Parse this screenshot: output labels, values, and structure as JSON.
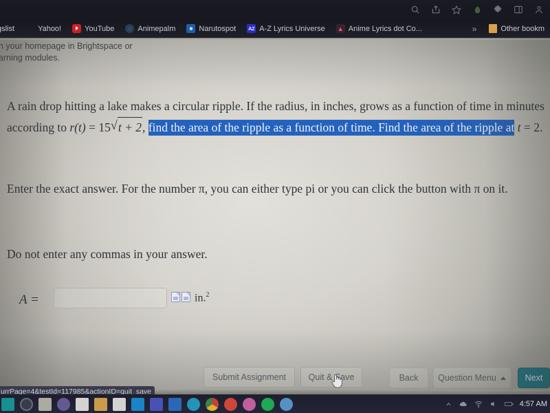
{
  "browser": {
    "toolbar_icons": [
      "search-icon",
      "share-icon",
      "star-icon",
      "leaf-icon",
      "extensions-puzzle-icon",
      "sidebar-icon",
      "profile-icon"
    ],
    "bookmarks": [
      {
        "label": "gslist",
        "icon": "generic-favicon"
      },
      {
        "label": "Yahoo!",
        "icon": "yahoo-favicon"
      },
      {
        "label": "YouTube",
        "icon": "youtube-favicon"
      },
      {
        "label": "Animepalm",
        "icon": "animepalm-favicon"
      },
      {
        "label": "Narutospot",
        "icon": "narutospot-favicon"
      },
      {
        "label": "A-Z Lyrics Universe",
        "icon": "az-lyrics-favicon"
      },
      {
        "label": "Anime Lyrics dot Co...",
        "icon": "anime-lyrics-favicon"
      }
    ],
    "overflow_label": "»",
    "other_bookmarks_label": "Other bookm"
  },
  "banner": {
    "line1": "n your homepage in Brightspace or",
    "line2": "arning modules."
  },
  "question": {
    "seg1": "A rain drop hitting a lake makes a circular ripple. If the radius, in inches, grows as a function of time in minutes according to ",
    "formula_r": "r",
    "formula_paren": "(t)",
    "formula_eq": "= 15",
    "formula_radicand": "t + 2",
    "formula_comma": ",",
    "highlighted": "find the area of the ripple as a function of time. Find the area of the ripple at",
    "tail_t": "t",
    "tail_eq": "= 2.",
    "instruction_1": "Enter the exact answer. For the number π, you can either type pi or you can click the button with π on it.",
    "instruction_2": "Do not enter any commas in your answer."
  },
  "answer": {
    "label": "A =",
    "input_value": "",
    "input_placeholder": "",
    "unit": "in.",
    "unit_exponent": "2",
    "helper_icons": [
      "broken-image-icon",
      "broken-image-icon"
    ]
  },
  "buttons": {
    "submit": "Submit Assignment",
    "quit_save": "Quit & Save",
    "back": "Back",
    "question_menu": "Question Menu",
    "next": "Next"
  },
  "status_bar": {
    "url": "urrPage=4&testId=117985&actionID=quit_save"
  },
  "taskbar": {
    "clock": "4:57 AM",
    "tray_icons": [
      "show-hidden-icon",
      "onedrive-icon",
      "network-icon",
      "volume-icon",
      "battery-icon"
    ],
    "app_icons": [
      "start-icon",
      "search-circle-icon",
      "task-view-icon",
      "people-icon",
      "notepad-icon",
      "file-explorer-icon",
      "store-icon",
      "mail-icon",
      "teams-icon",
      "office-icon",
      "edge-icon",
      "chrome-icon",
      "recording-icon",
      "photos-icon",
      "spotify-icon",
      "disc-icon"
    ]
  },
  "colors": {
    "selection_blue": "#2260bd",
    "next_button_teal": "#1f7a8c",
    "page_bg": "#d6d4cd"
  }
}
